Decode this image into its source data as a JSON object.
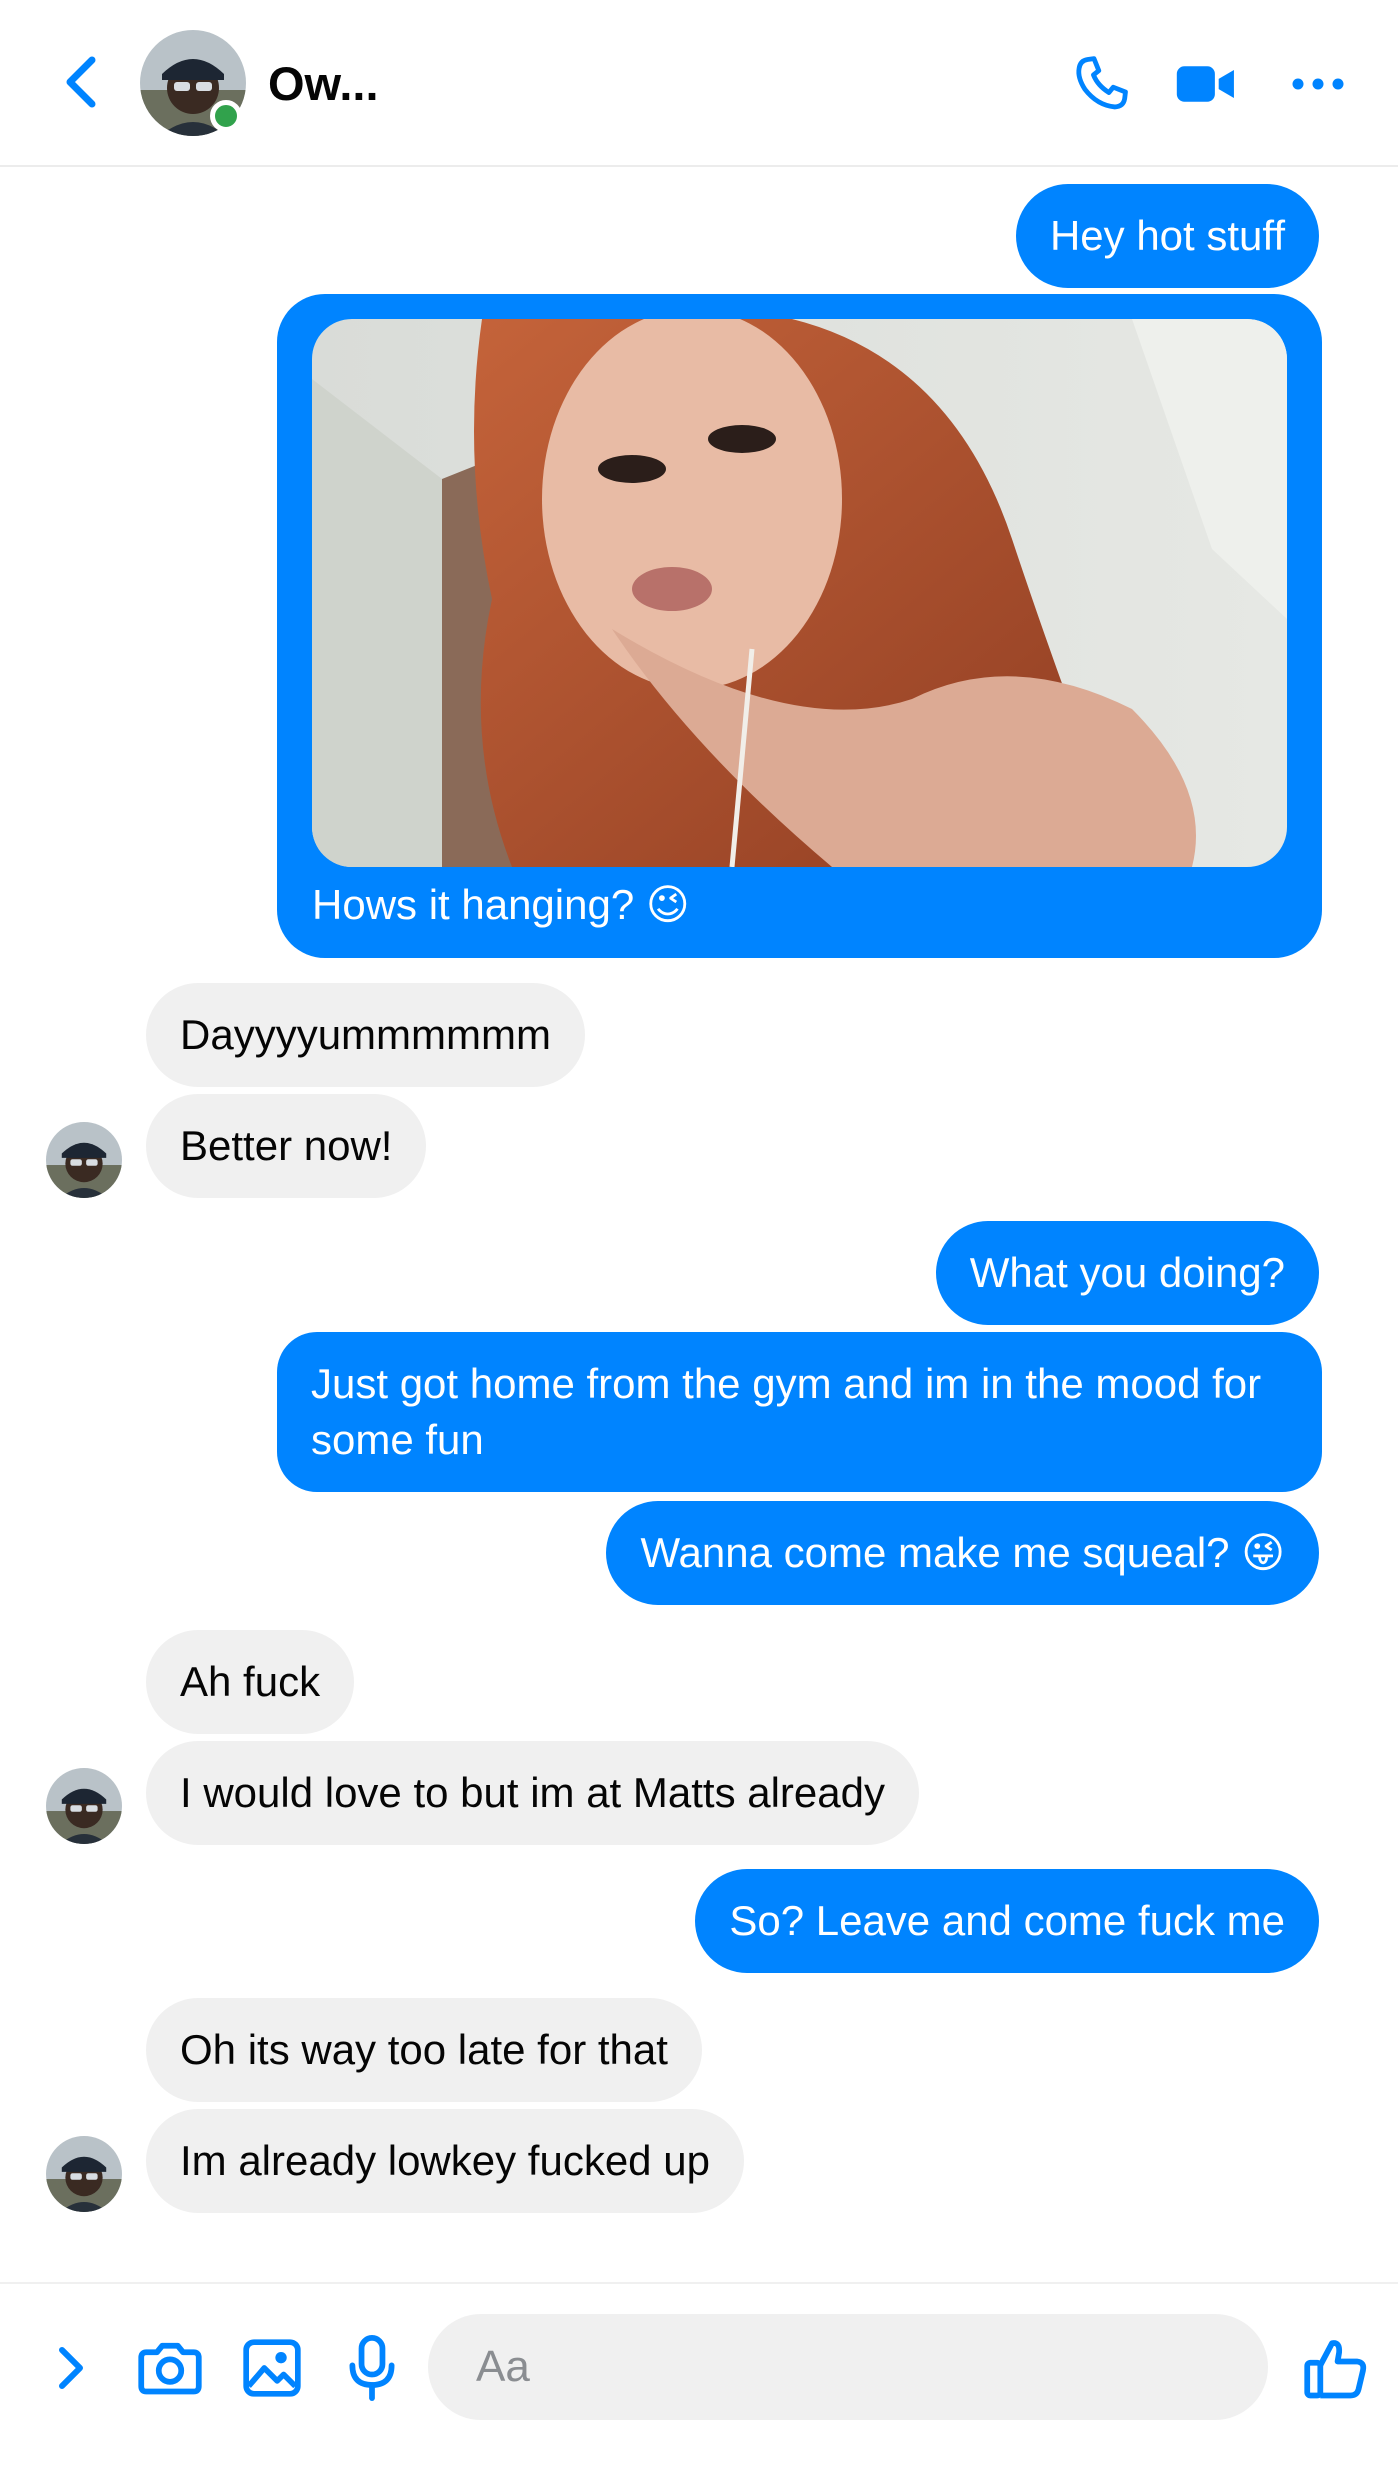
{
  "header": {
    "contact_name": "Ow...",
    "back_icon": "chevron-left-icon",
    "call_icon": "phone-icon",
    "video_icon": "video-camera-icon",
    "more_icon": "more-dots-icon",
    "accent_color": "#0084ff",
    "online_color": "#31a24c"
  },
  "messages": [
    {
      "id": "m1",
      "side": "outgoing",
      "text": "Hey hot stuff"
    },
    {
      "id": "m2",
      "side": "outgoing",
      "type": "photo",
      "caption": "Hows it hanging? 😉"
    },
    {
      "id": "m3",
      "side": "incoming",
      "text": "Dayyyyummmmmm"
    },
    {
      "id": "m4",
      "side": "incoming",
      "text": "Better now!"
    },
    {
      "id": "m5",
      "side": "outgoing",
      "text": "What you doing?"
    },
    {
      "id": "m6",
      "side": "outgoing",
      "text": "Just got home from the gym and im in the mood for some fun"
    },
    {
      "id": "m7",
      "side": "outgoing",
      "text": "Wanna come make me squeal? 😜"
    },
    {
      "id": "m8",
      "side": "incoming",
      "text": "Ah fuck"
    },
    {
      "id": "m9",
      "side": "incoming",
      "text": "I would love to but im at Matts already"
    },
    {
      "id": "m10",
      "side": "outgoing",
      "text": "So? Leave and come fuck me"
    },
    {
      "id": "m11",
      "side": "incoming",
      "text": "Oh its way too late for that"
    },
    {
      "id": "m12",
      "side": "incoming",
      "text": "Im already lowkey fucked up"
    }
  ],
  "composer": {
    "placeholder": "Aa",
    "expand_icon": "chevron-right-icon",
    "camera_icon": "camera-icon",
    "gallery_icon": "image-icon",
    "mic_icon": "microphone-icon",
    "like_icon": "thumbs-up-icon"
  },
  "colors": {
    "outgoing_bubble": "#0084ff",
    "incoming_bubble": "#f0f0f0"
  }
}
